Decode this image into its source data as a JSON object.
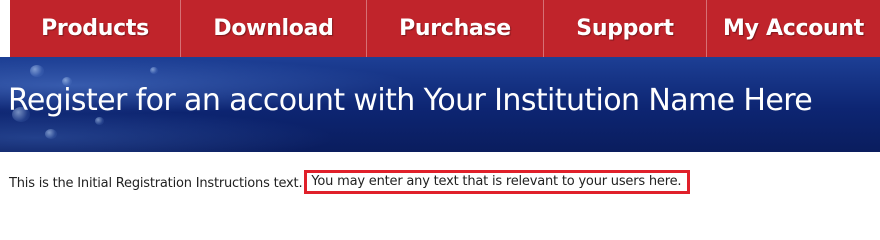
{
  "nav": {
    "items": [
      {
        "label": "Products"
      },
      {
        "label": "Download"
      },
      {
        "label": "Purchase"
      },
      {
        "label": "Support"
      },
      {
        "label": "My Account"
      }
    ]
  },
  "banner": {
    "title": "Register for an account with Your Institution Name Here"
  },
  "instructions": {
    "static_text": "This is the Initial Registration Instructions text.",
    "highlighted_text": "You may enter any text that is relevant to your users here."
  },
  "colors": {
    "nav_background": "#c0242b",
    "banner_background": "#0d2572",
    "highlight_border": "#e0202a"
  }
}
